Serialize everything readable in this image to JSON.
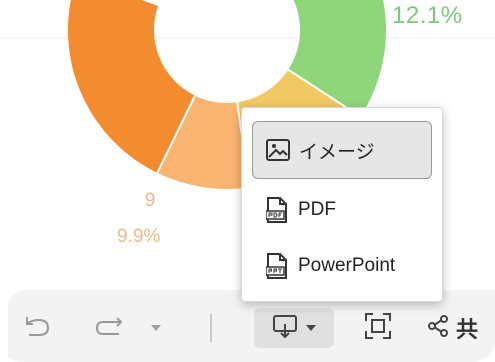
{
  "chart": {
    "top_percent": "12.1%",
    "slice_value": "9",
    "slice_percent": "9.9%"
  },
  "colors": {
    "orange": "#f28c2e",
    "light_orange": "#f9b46f",
    "yellow": "#f2c862",
    "green": "#8fd57a"
  },
  "menu": {
    "items": [
      {
        "label": "イメージ",
        "icon": "image-icon"
      },
      {
        "label": "PDF",
        "icon": "pdf-file-icon"
      },
      {
        "label": "PowerPoint",
        "icon": "ppt-file-icon"
      }
    ]
  },
  "toolbar": {
    "share_label": "共",
    "icons": [
      "undo-icon",
      "redo-icon",
      "redo-dropdown-icon",
      "download-icon",
      "fullscreen-icon",
      "share-icon"
    ]
  }
}
